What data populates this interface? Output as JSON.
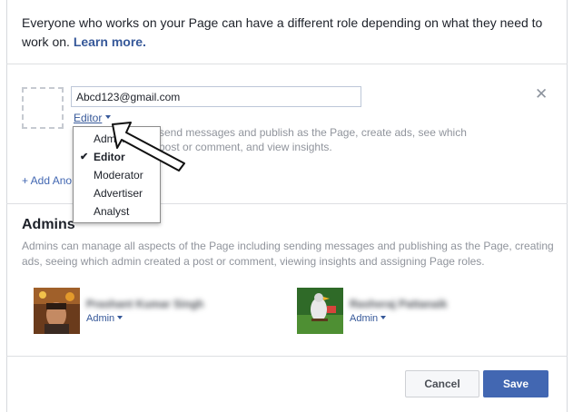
{
  "intro": {
    "text": "Everyone who works on your Page can have a different role depending on what they need to work on.",
    "learn_more": "Learn more."
  },
  "new_role": {
    "email_value": "Abcd123@gmail.com",
    "selected_role": "Editor",
    "description": "send messages and publish as the Page, create ads, see which post or comment, and view insights.",
    "add_another": "+ Add Ano",
    "dropdown_options": [
      {
        "label": "Admin",
        "selected": false
      },
      {
        "label": "Editor",
        "selected": true
      },
      {
        "label": "Moderator",
        "selected": false
      },
      {
        "label": "Advertiser",
        "selected": false
      },
      {
        "label": "Analyst",
        "selected": false
      }
    ]
  },
  "admins": {
    "title": "Admins",
    "description": "Admins can manage all aspects of the Page including sending messages and publishing as the Page, creating ads, seeing which admin created a post or comment, viewing insights and assigning Page roles.",
    "list": [
      {
        "name": "Prashant Kumar Singh",
        "role": "Admin"
      },
      {
        "name": "Rasheraj Pattanaik",
        "role": "Admin"
      }
    ]
  },
  "footer": {
    "cancel_label": "Cancel",
    "save_label": "Save"
  },
  "icons": {
    "close": "close-icon",
    "check": "check-icon",
    "caret": "caret-down-icon",
    "annotation": "arrow-icon"
  },
  "colors": {
    "link": "#365899",
    "primary_button": "#4267b2",
    "muted_text": "#90949c"
  }
}
